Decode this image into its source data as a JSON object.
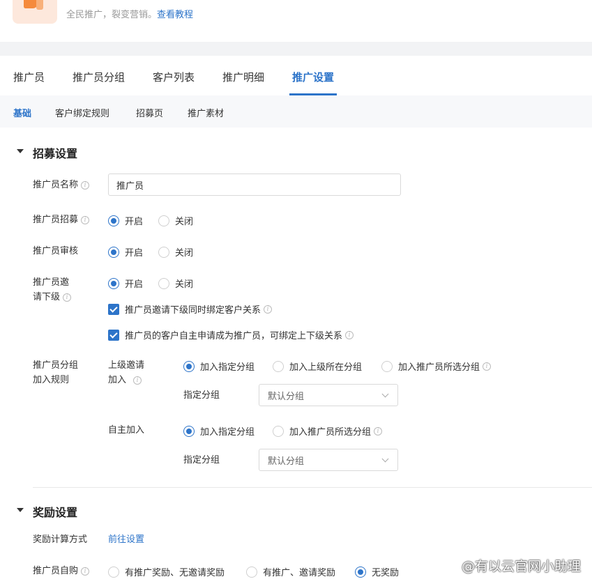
{
  "header": {
    "description": "全民推广，裂变营销。",
    "tutorial_link": "查看教程"
  },
  "tabs": [
    "推广员",
    "推广员分组",
    "客户列表",
    "推广明细",
    "推广设置"
  ],
  "active_tab": "推广设置",
  "subtabs": [
    "基础",
    "客户绑定规则",
    "招募页",
    "推广素材"
  ],
  "active_subtab": "基础",
  "recruit_section": {
    "title": "招募设置",
    "name_label": "推广员名称",
    "name_value": "推广员",
    "recruit_label": "推广员招募",
    "review_label": "推广员审核",
    "invite_label_1": "推广员邀",
    "invite_label_2": "请下级",
    "option_on": "开启",
    "option_off": "关闭",
    "check_1": "推广员邀请下级同时绑定客户关系",
    "check_2": "推广员的客户自主申请成为推广员，可绑定上下级关系",
    "group_rule_label_1": "推广员分组",
    "group_rule_label_2": "加入规则",
    "upper_invite_label_1": "上级邀请",
    "upper_invite_label_2": "加入",
    "opt_assign_group": "加入指定分组",
    "opt_upper_group": "加入上级所在分组",
    "opt_promoter_group": "加入推广员所选分组",
    "assign_group_label": "指定分组",
    "default_group": "默认分组",
    "self_join_label": "自主加入"
  },
  "reward_section": {
    "title": "奖励设置",
    "calc_label": "奖励计算方式",
    "calc_link": "前往设置",
    "self_buy_label": "推广员自购",
    "opt_1": "有推广奖励、无邀请奖励",
    "opt_2": "有推广、邀请奖励",
    "opt_3": "无奖励"
  },
  "watermark": "@有以云官网小助理",
  "colors": {
    "accent": "#2d74c9",
    "subtab_bg": "#f7f8fa",
    "gap_bg": "#f2f3f5",
    "icon_bg": "#fde8dc",
    "icon_fg": "#f58a3c"
  },
  "icons": [
    "megaphone-icon",
    "info-icon",
    "chevron-down-icon",
    "caret-down-icon",
    "checkmark-icon"
  ]
}
